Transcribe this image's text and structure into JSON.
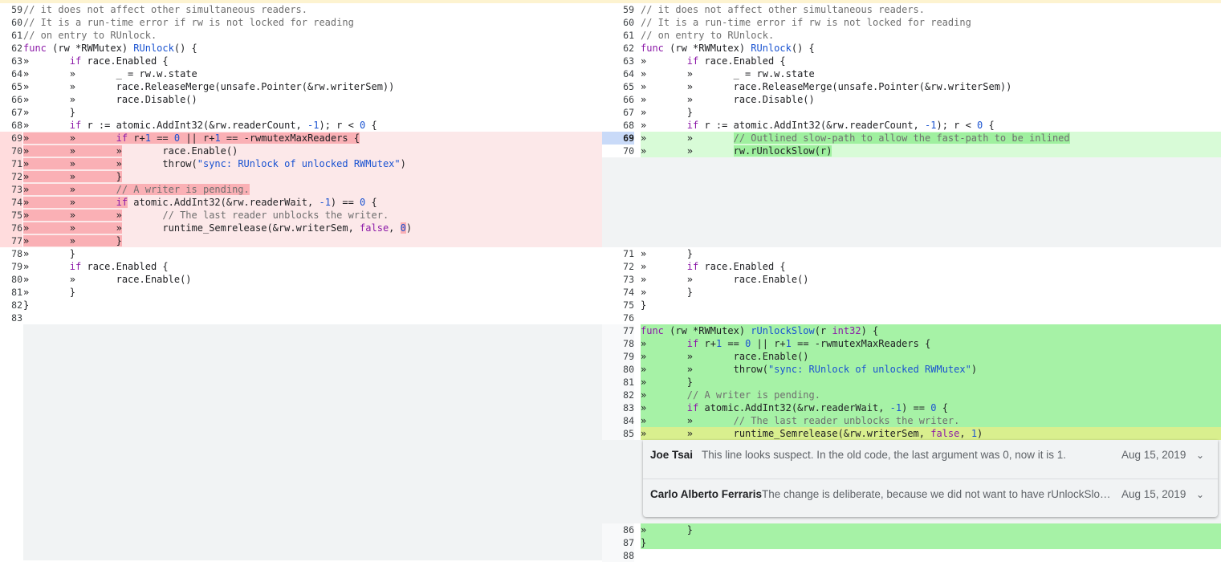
{
  "left_pane": {
    "rows": [
      {
        "num": "59",
        "cls": "",
        "code": "<span class='t-cm'>// it does not affect other simultaneous readers.</span>"
      },
      {
        "num": "60",
        "cls": "",
        "code": "<span class='t-cm'>// It is a run-time error if rw is not locked for reading</span>"
      },
      {
        "num": "61",
        "cls": "",
        "code": "<span class='t-cm'>// on entry to RUnlock.</span>"
      },
      {
        "num": "62",
        "cls": "",
        "code": "<span class='t-kw'>func</span> (rw *RWMutex) <span class='t-fn'>RUnlock</span>() {"
      },
      {
        "num": "63",
        "cls": "",
        "code": "»       <span class='t-kw'>if</span> race.Enabled {"
      },
      {
        "num": "64",
        "cls": "",
        "code": "»       »       _ = rw.w.state"
      },
      {
        "num": "65",
        "cls": "",
        "code": "»       »       race.ReleaseMerge(unsafe.Pointer(&amp;rw.writerSem))"
      },
      {
        "num": "66",
        "cls": "",
        "code": "»       »       race.Disable()"
      },
      {
        "num": "67",
        "cls": "",
        "code": "»       }"
      },
      {
        "num": "68",
        "cls": "",
        "code": "»       <span class='t-kw'>if</span> r := atomic.AddInt32(&amp;rw.readerCount, <span class='t-num'>-1</span>); r &lt; <span class='t-num'>0</span> {"
      },
      {
        "num": "69",
        "cls": "del",
        "code": "<span class='inline-del'>»       »       <span class='t-kw'>if</span> r+<span class='t-num'>1</span> == <span class='t-num'>0</span> || r+<span class='t-num'>1</span> == -rwmutexMaxReaders {</span>"
      },
      {
        "num": "70",
        "cls": "del",
        "code": "<span class='inline-del'>»       »       »</span>       race.Enable()"
      },
      {
        "num": "71",
        "cls": "del",
        "code": "<span class='inline-del'>»       »       »</span>       throw(<span class='t-str'>\"sync: RUnlock of unlocked RWMutex\"</span>)"
      },
      {
        "num": "72",
        "cls": "del",
        "code": "<span class='inline-del'>»       »       }</span>"
      },
      {
        "num": "73",
        "cls": "del",
        "code": "<span class='inline-del'>»       »       <span class='t-cm'>// A writer is pending.</span></span>"
      },
      {
        "num": "74",
        "cls": "del",
        "code": "<span class='inline-del'>»       »       <span class='t-kw'>if</span></span> atomic.AddInt32(&amp;rw.readerWait, <span class='t-num'>-1</span>) == <span class='t-num'>0</span> {"
      },
      {
        "num": "75",
        "cls": "del",
        "code": "<span class='inline-del'>»       »       »</span>       <span class='t-cm'>// The last reader unblocks the writer.</span>"
      },
      {
        "num": "76",
        "cls": "del",
        "code": "<span class='inline-del'>»       »       »</span>       runtime_Semrelease(&amp;rw.writerSem, <span class='t-kw'>false</span>, <span class='inline-del t-num'>0</span>)"
      },
      {
        "num": "77",
        "cls": "del",
        "code": "<span class='inline-del'>»       »       }</span>"
      },
      {
        "num": "78",
        "cls": "",
        "code": "»       }"
      },
      {
        "num": "79",
        "cls": "",
        "code": "»       <span class='t-kw'>if</span> race.Enabled {"
      },
      {
        "num": "80",
        "cls": "",
        "code": "»       »       race.Enable()"
      },
      {
        "num": "81",
        "cls": "",
        "code": "»       }"
      },
      {
        "num": "82",
        "cls": "",
        "code": "}"
      },
      {
        "num": "83",
        "cls": "",
        "code": ""
      }
    ]
  },
  "right_pane": {
    "rows_top": [
      {
        "num": "59",
        "cls": "",
        "code": "<span class='t-cm'>// it does not affect other simultaneous readers.</span>"
      },
      {
        "num": "60",
        "cls": "",
        "code": "<span class='t-cm'>// It is a run-time error if rw is not locked for reading</span>"
      },
      {
        "num": "61",
        "cls": "",
        "code": "<span class='t-cm'>// on entry to RUnlock.</span>"
      },
      {
        "num": "62",
        "cls": "",
        "code": "<span class='t-kw'>func</span> (rw *RWMutex) <span class='t-fn'>RUnlock</span>() {"
      },
      {
        "num": "63",
        "cls": "",
        "code": "»       <span class='t-kw'>if</span> race.Enabled {"
      },
      {
        "num": "64",
        "cls": "",
        "code": "»       »       _ = rw.w.state"
      },
      {
        "num": "65",
        "cls": "",
        "code": "»       »       race.ReleaseMerge(unsafe.Pointer(&amp;rw.writerSem))"
      },
      {
        "num": "66",
        "cls": "",
        "code": "»       »       race.Disable()"
      },
      {
        "num": "67",
        "cls": "",
        "code": "»       }"
      },
      {
        "num": "68",
        "cls": "",
        "code": "»       <span class='t-kw'>if</span> r := atomic.AddInt32(&amp;rw.readerCount, <span class='t-num'>-1</span>); r &lt; <span class='t-num'>0</span> {"
      },
      {
        "num": "69",
        "cls": "add sel",
        "code": "»       »       <span class='inline-add t-cm'>// Outlined slow-path to allow the fast-path to be inlined</span>"
      },
      {
        "num": "70",
        "cls": "add",
        "code": "»       »       <span class='inline-add'>rw.rUnlockSlow(r)</span>"
      }
    ],
    "rows_mid": [
      {
        "num": "71",
        "cls": "",
        "code": "»       }"
      },
      {
        "num": "72",
        "cls": "",
        "code": "»       <span class='t-kw'>if</span> race.Enabled {"
      },
      {
        "num": "73",
        "cls": "",
        "code": "»       »       race.Enable()"
      },
      {
        "num": "74",
        "cls": "",
        "code": "»       }"
      },
      {
        "num": "75",
        "cls": "",
        "code": "}"
      },
      {
        "num": "76",
        "cls": "",
        "code": ""
      },
      {
        "num": "77",
        "cls": "addbig",
        "code": "<span class='t-kw'>func</span> (rw *RWMutex) <span class='t-fn'>rUnlockSlow</span>(r <span class='t-kw'>int32</span>) {"
      },
      {
        "num": "78",
        "cls": "addbig",
        "code": "»       <span class='t-kw'>if</span> r+<span class='t-num'>1</span> == <span class='t-num'>0</span> || r+<span class='t-num'>1</span> == -rwmutexMaxReaders {"
      },
      {
        "num": "79",
        "cls": "addbig",
        "code": "»       »       race.Enable()"
      },
      {
        "num": "80",
        "cls": "addbig",
        "code": "»       »       throw(<span class='t-str'>\"sync: RUnlock of unlocked RWMutex\"</span>)"
      },
      {
        "num": "81",
        "cls": "addbig",
        "code": "»       }"
      },
      {
        "num": "82",
        "cls": "addbig",
        "code": "»       <span class='t-cm'>// A writer is pending.</span>"
      },
      {
        "num": "83",
        "cls": "addbig",
        "code": "»       <span class='t-kw'>if</span> atomic.AddInt32(&amp;rw.readerWait, <span class='t-num'>-1</span>) == <span class='t-num'>0</span> {"
      },
      {
        "num": "84",
        "cls": "addbig",
        "code": "»       »       <span class='t-cm'>// The last reader unblocks the writer.</span>"
      },
      {
        "num": "85",
        "cls": "addbig hl",
        "code": "»       »       runtime_Semrelease(&amp;rw.writerSem, <span class='t-kw'>false</span>, <span class='t-num'>1</span>)"
      }
    ],
    "rows_bottom": [
      {
        "num": "86",
        "cls": "addbig",
        "code": "»       }"
      },
      {
        "num": "87",
        "cls": "addbig",
        "code": "}"
      },
      {
        "num": "88",
        "cls": "addbig",
        "code": ""
      }
    ]
  },
  "comments": [
    {
      "author": "Joe Tsai",
      "message": "This line looks suspect. In the old code, the last argument was 0, now it is 1.",
      "date": "Aug 15, 2019"
    },
    {
      "author": "Carlo Alberto Ferraris",
      "message": "The change is deliberate, because we did not want to have rUnlockSlow inlined",
      "date": "Aug 15, 2019"
    }
  ]
}
